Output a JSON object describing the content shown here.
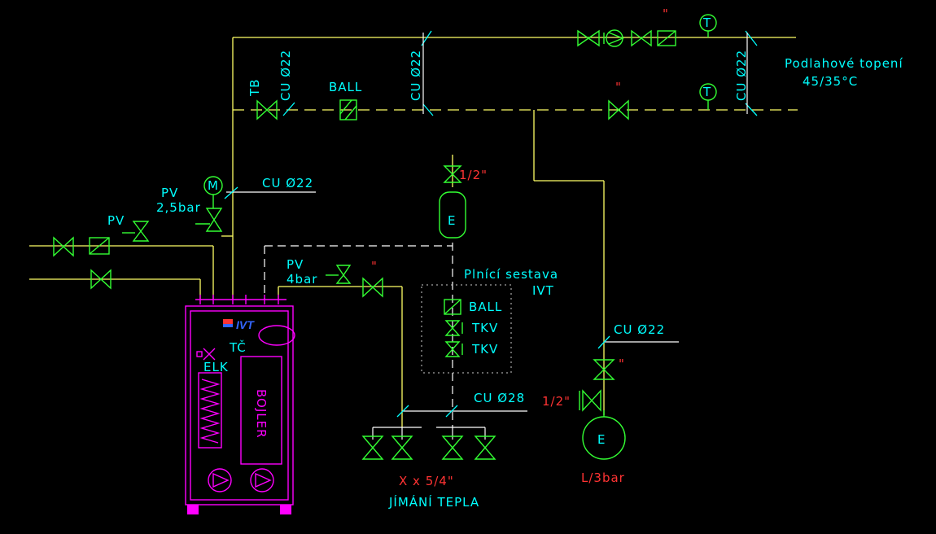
{
  "labels": {
    "floor_heating": "Podlahové topení",
    "floor_temp": "45/35°C",
    "tb": "TB",
    "ball": "BALL",
    "cu22_a": "CU Ø22",
    "cu22_b": "CU Ø22",
    "cu22_c": "CU Ø22",
    "cu22_d": "CU Ø22",
    "cu22_e": "CU Ø22",
    "cu28": "CU Ø28",
    "pv_25": "PV",
    "pv_25_bar": "2,5bar",
    "pv_main": "PV",
    "pv_4": "PV",
    "pv_4_bar": "4bar",
    "half_inch_top": "1/2\"",
    "half_inch_bottom": "1/2\"",
    "expansion_e": "E",
    "expansion_e_bottom": "E",
    "l3bar": "L/3bar",
    "fill_set_1": "Plnící sestava",
    "fill_set_2": "IVT",
    "fill_ball": "BALL",
    "tkv_1": "TKV",
    "tkv_2": "TKV",
    "xx54": "X x 5/4\"",
    "heat_collection": "JÍMÁNÍ TEPLA",
    "tc": "TČ",
    "elk": "ELK",
    "bojler": "BOJLER",
    "ivt_logo": "IVT",
    "motor_m": "M",
    "thermo_1": "T",
    "thermo_2": "T"
  },
  "colors": {
    "background": "#000000",
    "pipe": "#ffff66",
    "label": "#00ffff",
    "valve": "#33ff33",
    "unit": "#ff00ff",
    "dimension": "#ff3333"
  }
}
